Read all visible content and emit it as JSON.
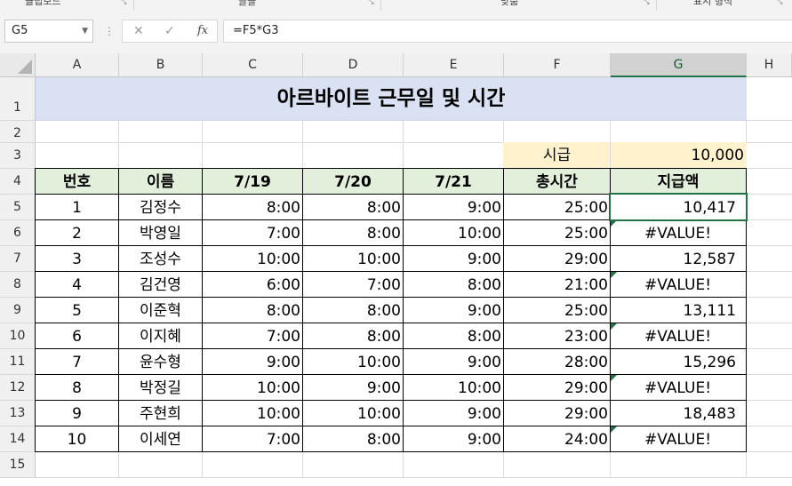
{
  "ribbon": {
    "groups": [
      {
        "label": "클립보드"
      },
      {
        "label": "글꼴"
      },
      {
        "label": "맞춤"
      },
      {
        "label": "표시 형식"
      }
    ]
  },
  "formula_bar": {
    "name_box": "G5",
    "cancel_icon": "✕",
    "enter_icon": "✓",
    "fx_label": "fx",
    "formula": "=F5*G3"
  },
  "columns": [
    "A",
    "B",
    "C",
    "D",
    "E",
    "F",
    "G",
    "H"
  ],
  "rows": [
    "1",
    "2",
    "3",
    "4",
    "5",
    "6",
    "7",
    "8",
    "9",
    "10",
    "11",
    "12",
    "13",
    "14",
    "15"
  ],
  "selected_column": "G",
  "sheet": {
    "title": "아르바이트 근무일 및 시간",
    "wage_label": "시급",
    "wage_value": "10,000",
    "headers": [
      "번호",
      "이름",
      "7/19",
      "7/20",
      "7/21",
      "총시간",
      "지급액"
    ],
    "data_rows": [
      {
        "no": "1",
        "name": "김정수",
        "d1": "8:00",
        "d2": "8:00",
        "d3": "9:00",
        "total": "25:00",
        "pay": "10,417",
        "error": false
      },
      {
        "no": "2",
        "name": "박영일",
        "d1": "7:00",
        "d2": "8:00",
        "d3": "10:00",
        "total": "25:00",
        "pay": "#VALUE!",
        "error": true
      },
      {
        "no": "3",
        "name": "조성수",
        "d1": "10:00",
        "d2": "10:00",
        "d3": "9:00",
        "total": "29:00",
        "pay": "12,587",
        "error": false
      },
      {
        "no": "4",
        "name": "김건영",
        "d1": "6:00",
        "d2": "7:00",
        "d3": "8:00",
        "total": "21:00",
        "pay": "#VALUE!",
        "error": true
      },
      {
        "no": "5",
        "name": "이준혁",
        "d1": "8:00",
        "d2": "8:00",
        "d3": "9:00",
        "total": "25:00",
        "pay": "13,111",
        "error": false
      },
      {
        "no": "6",
        "name": "이지혜",
        "d1": "7:00",
        "d2": "8:00",
        "d3": "8:00",
        "total": "23:00",
        "pay": "#VALUE!",
        "error": true
      },
      {
        "no": "7",
        "name": "윤수형",
        "d1": "9:00",
        "d2": "10:00",
        "d3": "9:00",
        "total": "28:00",
        "pay": "15,296",
        "error": false
      },
      {
        "no": "8",
        "name": "박정길",
        "d1": "10:00",
        "d2": "9:00",
        "d3": "10:00",
        "total": "29:00",
        "pay": "#VALUE!",
        "error": true
      },
      {
        "no": "9",
        "name": "주현희",
        "d1": "10:00",
        "d2": "10:00",
        "d3": "9:00",
        "total": "29:00",
        "pay": "18,483",
        "error": false
      },
      {
        "no": "10",
        "name": "이세연",
        "d1": "7:00",
        "d2": "8:00",
        "d3": "9:00",
        "total": "24:00",
        "pay": "#VALUE!",
        "error": true
      }
    ]
  },
  "colors": {
    "title_fill": "#d9e1f2",
    "header_fill": "#e2efda",
    "wage_fill": "#fff2cc",
    "accent": "#217346"
  }
}
